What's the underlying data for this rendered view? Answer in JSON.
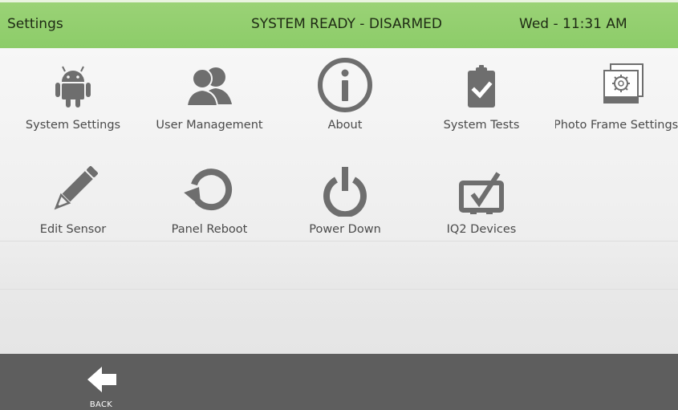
{
  "header": {
    "title": "Settings",
    "status": "SYSTEM READY - DISARMED",
    "datetime": "Wed - 11:31 AM"
  },
  "grid": {
    "row1": [
      {
        "label": "System Settings",
        "icon": "android-icon"
      },
      {
        "label": "User Management",
        "icon": "users-icon"
      },
      {
        "label": "About",
        "icon": "info-icon"
      },
      {
        "label": "System Tests",
        "icon": "clipboard-check-icon"
      },
      {
        "label": "Photo Frame Settings",
        "icon": "photo-frame-gear-icon"
      }
    ],
    "row2": [
      {
        "label": "Edit Sensor",
        "icon": "pencil-icon"
      },
      {
        "label": "Panel Reboot",
        "icon": "reboot-icon"
      },
      {
        "label": "Power Down",
        "icon": "power-icon"
      },
      {
        "label": "IQ2 Devices",
        "icon": "tablet-check-icon"
      }
    ]
  },
  "footer": {
    "back_label": "BACK"
  },
  "colors": {
    "header_green": "#8ccc68",
    "icon_gray": "#6e6e6e",
    "footer_gray": "#5e5e5e"
  }
}
